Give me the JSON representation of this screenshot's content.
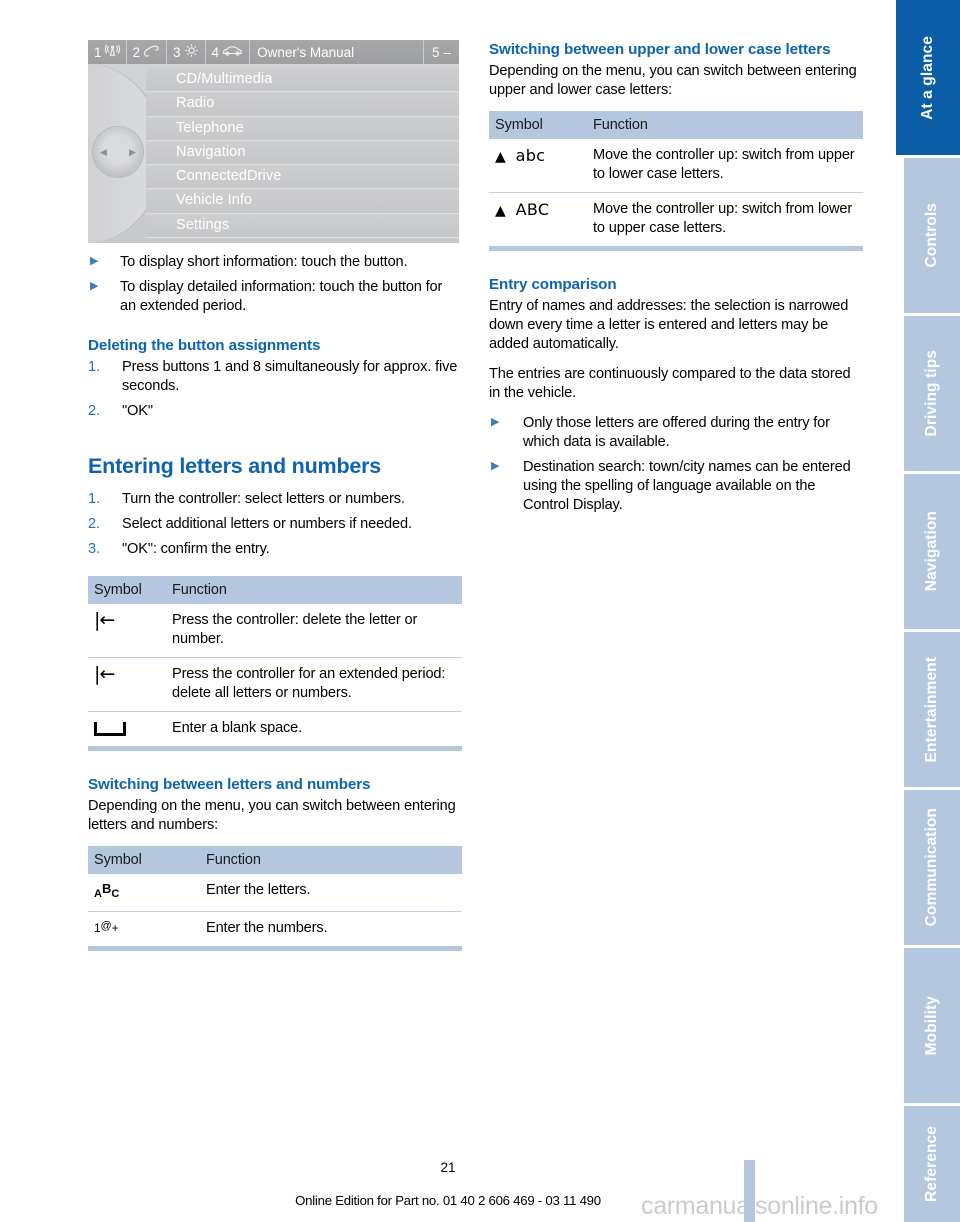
{
  "idrive": {
    "menubar": [
      {
        "number": "1",
        "icon": "radio-antenna-icon"
      },
      {
        "number": "2",
        "icon": "telephone-handset-icon"
      },
      {
        "number": "3",
        "icon": "gear-icon"
      },
      {
        "number": "4",
        "icon": "car-icon"
      }
    ],
    "title": "Owner's Manual",
    "right_number": "5",
    "right_symbol": "–",
    "menu_items": [
      "CD/Multimedia",
      "Radio",
      "Telephone",
      "Navigation",
      "ConnectedDrive",
      "Vehicle Info",
      "Settings"
    ]
  },
  "left_column": {
    "bullets_top": [
      "To display short information: touch the button.",
      "To display detailed information: touch the button for an extended period."
    ],
    "deleting_heading": "Deleting the button assignments",
    "deleting_steps": [
      {
        "num": "1.",
        "text": "Press buttons 1 and 8 simultaneously for approx. five seconds."
      },
      {
        "num": "2.",
        "text": "\"OK\""
      }
    ],
    "entering_heading": "Entering letters and numbers",
    "entering_steps": [
      {
        "num": "1.",
        "text": "Turn the controller: select letters or numbers."
      },
      {
        "num": "2.",
        "text": "Select additional letters or numbers if needed."
      },
      {
        "num": "3.",
        "text": "\"OK\": confirm the entry."
      }
    ],
    "table_delete": {
      "headers": [
        "Symbol",
        "Function"
      ],
      "rows": [
        {
          "symbol": "|←",
          "symbol_name": "backspace-icon",
          "function": "Press the controller: delete the letter or number."
        },
        {
          "symbol": "|←",
          "symbol_name": "backspace-icon",
          "function": "Press the controller for an extended period: delete all letters or numbers."
        },
        {
          "symbol": "⌴",
          "symbol_name": "blank-space-icon",
          "function": "Enter a blank space."
        }
      ]
    },
    "switch_letters_heading": "Switching between letters and numbers",
    "switch_letters_intro": "Depending on the menu, you can switch between entering letters and numbers:",
    "table_letters": {
      "headers": [
        "Symbol",
        "Function"
      ],
      "rows": [
        {
          "symbol_a": "A",
          "symbol_b": "B",
          "symbol_c": "C",
          "symbol_name": "abc-letters-icon",
          "function": "Enter the letters."
        },
        {
          "symbol_a": "1",
          "symbol_b": "@",
          "symbol_c": "+",
          "symbol_name": "numbers-symbols-icon",
          "function": "Enter the numbers."
        }
      ]
    }
  },
  "right_column": {
    "switch_case_heading": "Switching between upper and lower case letters",
    "switch_case_intro": "Depending on the menu, you can switch between entering upper and lower case letters:",
    "table_case": {
      "headers": [
        "Symbol",
        "Function"
      ],
      "rows": [
        {
          "arrow": "▲",
          "label": "abc",
          "symbol_name": "up-arrow-lowercase-icon",
          "function": "Move the controller up: switch from upper to lower case letters."
        },
        {
          "arrow": "▲",
          "label": "ABC",
          "symbol_name": "up-arrow-uppercase-icon",
          "function": "Move the controller up: switch from lower to upper case letters."
        }
      ]
    },
    "entry_comparison_heading": "Entry comparison",
    "entry_paragraphs": [
      "Entry of names and addresses: the selection is narrowed down every time a letter is entered and letters may be added automatically.",
      "The entries are continuously compared to the data stored in the vehicle."
    ],
    "entry_bullets": [
      "Only those letters are offered during the entry for which data is available.",
      "Destination search: town/city names can be entered using the spelling of language available on the Control Display."
    ]
  },
  "sidebar": {
    "tabs": [
      {
        "label": "At a glance",
        "active": true
      },
      {
        "label": "Controls",
        "active": false
      },
      {
        "label": "Driving tips",
        "active": false
      },
      {
        "label": "Navigation",
        "active": false
      },
      {
        "label": "Entertainment",
        "active": false
      },
      {
        "label": "Communication",
        "active": false
      },
      {
        "label": "Mobility",
        "active": false
      },
      {
        "label": "Reference",
        "active": false
      }
    ],
    "active_color": "#0b5ea6",
    "inactive_color": "#b5c7de"
  },
  "footer": {
    "page_number": "21",
    "edition_line": "Online Edition for Part no. 01 40 2 606 469 - 03 11 490",
    "watermark": "carmanualsonline.info"
  }
}
